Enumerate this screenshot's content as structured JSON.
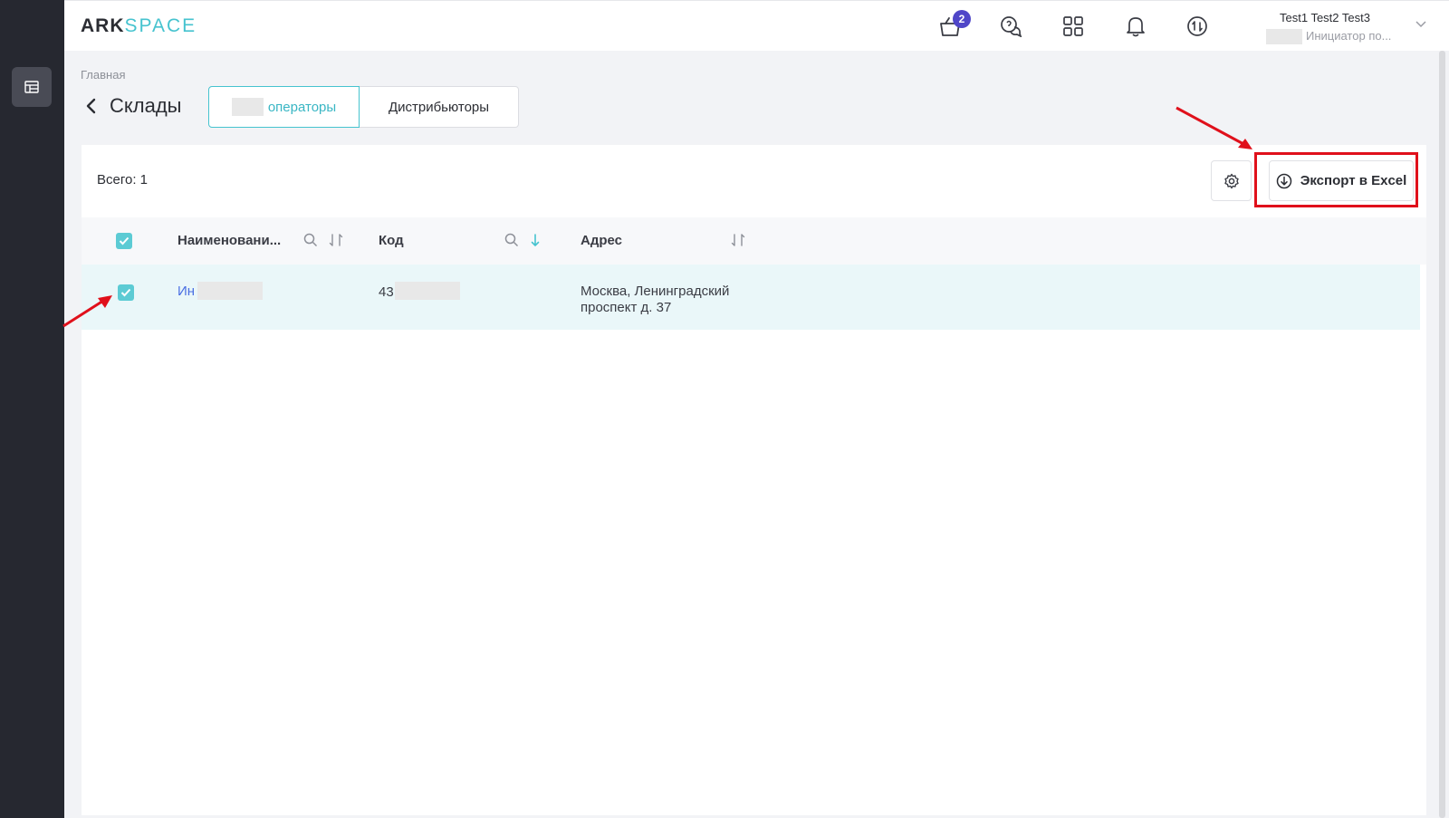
{
  "app": {
    "logo_part1": "ARK",
    "logo_part2": "SPACE",
    "accent_color": "#46c3cf",
    "sidebar_color": "#262830"
  },
  "header": {
    "cart_badge": "2",
    "icons": [
      "cart-icon",
      "support-chat-icon",
      "apps-grid-icon",
      "bell-icon",
      "sync-icon"
    ],
    "user": {
      "name": "Test1 Test2 Test3",
      "role": "Инициатор по..."
    }
  },
  "breadcrumb": "Главная",
  "page": {
    "title": "Склады",
    "tabs": [
      {
        "label": "операторы",
        "active": true
      },
      {
        "label": "Дистрибьюторы",
        "active": false
      }
    ]
  },
  "toolbar": {
    "total": "Всего: 1",
    "export_label": "Экспорт в Excel"
  },
  "table": {
    "columns": [
      "Наименовани...",
      "Код",
      "Адрес"
    ],
    "rows": [
      {
        "name": "Ин",
        "code": "43․",
        "address_line1": "Москва, Ленинградский",
        "address_line2": "проспект д. 37",
        "checked": true
      }
    ]
  },
  "annotations": {
    "highlight_color": "#e0101b"
  }
}
